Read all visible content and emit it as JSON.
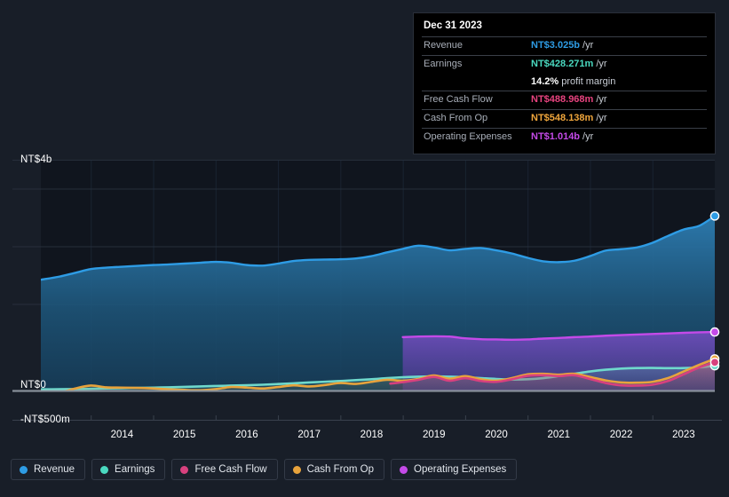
{
  "theme": {
    "page_bg": "#181e28",
    "plot_bg": "#10151e",
    "grid_color": "#2b3340",
    "zero_line_color": "#9aa3ad",
    "axis_line_color": "#39414d",
    "tooltip_bg": "#000000"
  },
  "tooltip": {
    "title": "Dec 31 2023",
    "rows": [
      {
        "label": "Revenue",
        "value": "NT$3.025b",
        "unit": "/yr",
        "color": "#2e9ce5"
      },
      {
        "label": "Earnings",
        "value": "NT$428.271m",
        "unit": "/yr",
        "color": "#4ad9c0"
      },
      {
        "label": "",
        "value": "14.2%",
        "unit": "profit margin",
        "color": "#ffffff"
      },
      {
        "label": "Free Cash Flow",
        "value": "NT$488.968m",
        "unit": "/yr",
        "color": "#e8437f"
      },
      {
        "label": "Cash From Op",
        "value": "NT$548.138m",
        "unit": "/yr",
        "color": "#f0a63c"
      },
      {
        "label": "Operating Expenses",
        "value": "NT$1.014b",
        "unit": "/yr",
        "color": "#c44ae8"
      }
    ]
  },
  "legend": {
    "items": [
      {
        "label": "Revenue",
        "color": "#2e9ce5"
      },
      {
        "label": "Earnings",
        "color": "#4ad9c0"
      },
      {
        "label": "Free Cash Flow",
        "color": "#d8417e"
      },
      {
        "label": "Cash From Op",
        "color": "#e8a33c"
      },
      {
        "label": "Operating Expenses",
        "color": "#c44ae8"
      }
    ]
  },
  "chart_data": {
    "type": "area",
    "title": "",
    "xlabel": "",
    "ylabel": "",
    "grid": true,
    "legend_position": "bottom",
    "y_axis": {
      "labels": [
        "NT$4b",
        "NT$0",
        "-NT$500m"
      ],
      "label_values": [
        4000,
        0,
        -500
      ],
      "unit": "NT$ millions",
      "ylim": [
        -500,
        4400
      ],
      "gridline_values": [
        4000,
        3500,
        2500,
        1500,
        0
      ]
    },
    "x_axis": {
      "tick_labels": [
        "2014",
        "2015",
        "2016",
        "2017",
        "2018",
        "2019",
        "2020",
        "2021",
        "2022",
        "2023"
      ],
      "xlim": [
        "2013.2",
        "2024.0"
      ]
    },
    "series": [
      {
        "name": "Revenue",
        "color": "#2e9ce5",
        "fill": "#1d4a6b",
        "x": [
          2013.2,
          2013.5,
          2013.75,
          2014.0,
          2014.25,
          2014.5,
          2014.75,
          2015.0,
          2015.25,
          2015.5,
          2015.75,
          2016.0,
          2016.25,
          2016.5,
          2016.75,
          2017.0,
          2017.25,
          2017.5,
          2017.75,
          2018.0,
          2018.25,
          2018.5,
          2018.75,
          2019.0,
          2019.25,
          2019.5,
          2019.75,
          2020.0,
          2020.25,
          2020.5,
          2020.75,
          2021.0,
          2021.25,
          2021.5,
          2021.75,
          2022.0,
          2022.25,
          2022.5,
          2022.75,
          2023.0,
          2023.25,
          2023.5,
          2023.75,
          2024.0
        ],
        "y": [
          1920,
          1975,
          2040,
          2105,
          2130,
          2145,
          2160,
          2175,
          2185,
          2200,
          2215,
          2230,
          2215,
          2175,
          2165,
          2200,
          2245,
          2265,
          2270,
          2275,
          2290,
          2330,
          2395,
          2455,
          2510,
          2480,
          2430,
          2455,
          2470,
          2430,
          2375,
          2300,
          2240,
          2225,
          2250,
          2330,
          2425,
          2450,
          2480,
          2560,
          2680,
          2790,
          2855,
          3025
        ]
      },
      {
        "name": "Operating Expenses",
        "color": "#c44ae8",
        "fill": "#4b3a86",
        "x": [
          2019.0,
          2019.25,
          2019.5,
          2019.75,
          2020.0,
          2020.25,
          2020.5,
          2020.75,
          2021.0,
          2021.25,
          2021.5,
          2021.75,
          2022.0,
          2022.25,
          2022.5,
          2022.75,
          2023.0,
          2023.25,
          2023.5,
          2023.75,
          2024.0
        ],
        "y": [
          925,
          935,
          940,
          935,
          905,
          890,
          885,
          880,
          885,
          900,
          910,
          925,
          935,
          950,
          960,
          970,
          980,
          990,
          1000,
          1008,
          1014
        ]
      },
      {
        "name": "Cash From Op",
        "color": "#e8a33c",
        "fill": "rgba(232,163,60,0.10)",
        "x": [
          2013.2,
          2013.5,
          2013.75,
          2014.0,
          2014.25,
          2014.5,
          2014.75,
          2015.0,
          2015.25,
          2015.5,
          2015.75,
          2016.0,
          2016.25,
          2016.5,
          2016.75,
          2017.0,
          2017.25,
          2017.5,
          2017.75,
          2018.0,
          2018.25,
          2018.5,
          2018.75,
          2019.0,
          2019.25,
          2019.5,
          2019.75,
          2020.0,
          2020.25,
          2020.5,
          2020.75,
          2021.0,
          2021.25,
          2021.5,
          2021.75,
          2022.0,
          2022.25,
          2022.5,
          2022.75,
          2023.0,
          2023.25,
          2023.5,
          2023.75,
          2024.0
        ],
        "y": [
          -95,
          -40,
          35,
          85,
          55,
          50,
          45,
          35,
          20,
          10,
          5,
          25,
          60,
          50,
          35,
          60,
          90,
          70,
          95,
          130,
          115,
          150,
          185,
          170,
          200,
          260,
          205,
          250,
          195,
          170,
          215,
          280,
          290,
          275,
          290,
          235,
          175,
          140,
          135,
          150,
          215,
          330,
          445,
          548
        ]
      },
      {
        "name": "Free Cash Flow",
        "color": "#d8417e",
        "fill": "rgba(216,65,126,0.16)",
        "x": [
          2018.8,
          2019.0,
          2019.25,
          2019.5,
          2019.75,
          2020.0,
          2020.25,
          2020.5,
          2020.75,
          2021.0,
          2021.25,
          2021.5,
          2021.75,
          2022.0,
          2022.25,
          2022.5,
          2022.75,
          2023.0,
          2023.25,
          2023.5,
          2023.75,
          2024.0
        ],
        "y": [
          120,
          145,
          185,
          235,
          170,
          215,
          165,
          150,
          195,
          255,
          265,
          250,
          265,
          200,
          130,
          90,
          85,
          100,
          165,
          280,
          400,
          489
        ]
      },
      {
        "name": "Earnings",
        "color": "#6fd9cc",
        "fill": "rgba(111,217,204,0.12)",
        "x": [
          2013.2,
          2013.5,
          2013.75,
          2014.0,
          2014.25,
          2014.5,
          2014.75,
          2015.0,
          2015.25,
          2015.5,
          2015.75,
          2016.0,
          2016.25,
          2016.5,
          2016.75,
          2017.0,
          2017.25,
          2017.5,
          2017.75,
          2018.0,
          2018.25,
          2018.5,
          2018.75,
          2019.0,
          2019.25,
          2019.5,
          2019.75,
          2020.0,
          2020.25,
          2020.5,
          2020.75,
          2021.0,
          2021.25,
          2021.5,
          2021.75,
          2022.0,
          2022.25,
          2022.5,
          2022.75,
          2023.0,
          2023.25,
          2023.5,
          2023.75,
          2024.0
        ],
        "y": [
          20,
          22,
          25,
          30,
          35,
          40,
          45,
          50,
          55,
          62,
          70,
          78,
          85,
          92,
          100,
          112,
          125,
          140,
          152,
          165,
          180,
          195,
          215,
          230,
          240,
          245,
          240,
          230,
          215,
          200,
          190,
          195,
          215,
          250,
          290,
          330,
          360,
          380,
          390,
          392,
          388,
          390,
          400,
          428
        ]
      }
    ]
  }
}
